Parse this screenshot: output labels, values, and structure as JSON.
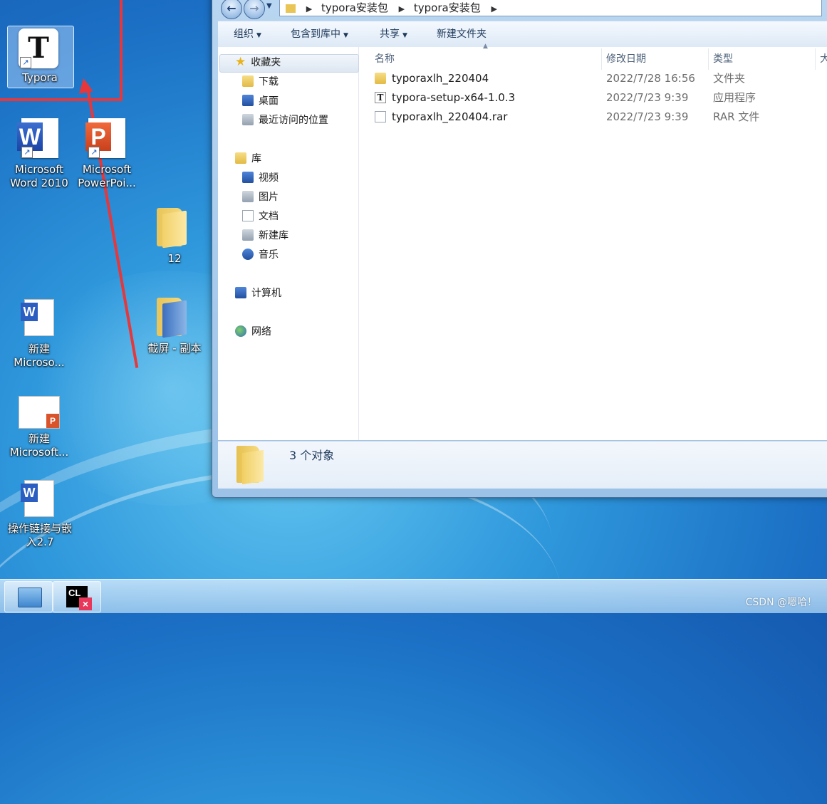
{
  "desktop": {
    "icons": [
      {
        "label": "Typora"
      },
      {
        "label": "Microsoft Word 2010"
      },
      {
        "label": "Microsoft PowerPoi..."
      },
      {
        "label": "12"
      },
      {
        "label": "截屏 - 副本"
      },
      {
        "label": "新建 Microso..."
      },
      {
        "label": "新建 Microsoft..."
      },
      {
        "label": "操作链接与嵌入2.7"
      }
    ]
  },
  "explorer": {
    "path": [
      "typora安装包",
      "typora安装包"
    ],
    "toolbar": {
      "organize": "组织",
      "include_in_library": "包含到库中",
      "share": "共享",
      "new_folder": "新建文件夹"
    },
    "nav": {
      "favorites": "收藏夹",
      "downloads": "下载",
      "desktop": "桌面",
      "recent": "最近访问的位置",
      "libraries": "库",
      "videos": "视频",
      "pictures": "图片",
      "documents": "文档",
      "new_library": "新建库",
      "music": "音乐",
      "computer": "计算机",
      "network": "网络"
    },
    "columns": {
      "name": "名称",
      "modified": "修改日期",
      "type": "类型",
      "size": "大"
    },
    "files": [
      {
        "name": "typoraxlh_220404",
        "modified": "2022/7/28 16:56",
        "type": "文件夹",
        "icon": "folder-icon"
      },
      {
        "name": "typora-setup-x64-1.0.3",
        "modified": "2022/7/23 9:39",
        "type": "应用程序",
        "icon": "typora-app-icon"
      },
      {
        "name": "typoraxlh_220404.rar",
        "modified": "2022/7/23 9:39",
        "type": "RAR 文件",
        "icon": "file-icon"
      }
    ],
    "status": "3 个对象"
  },
  "taskbar": {
    "watermark": "CSDN @嗯哈！"
  }
}
